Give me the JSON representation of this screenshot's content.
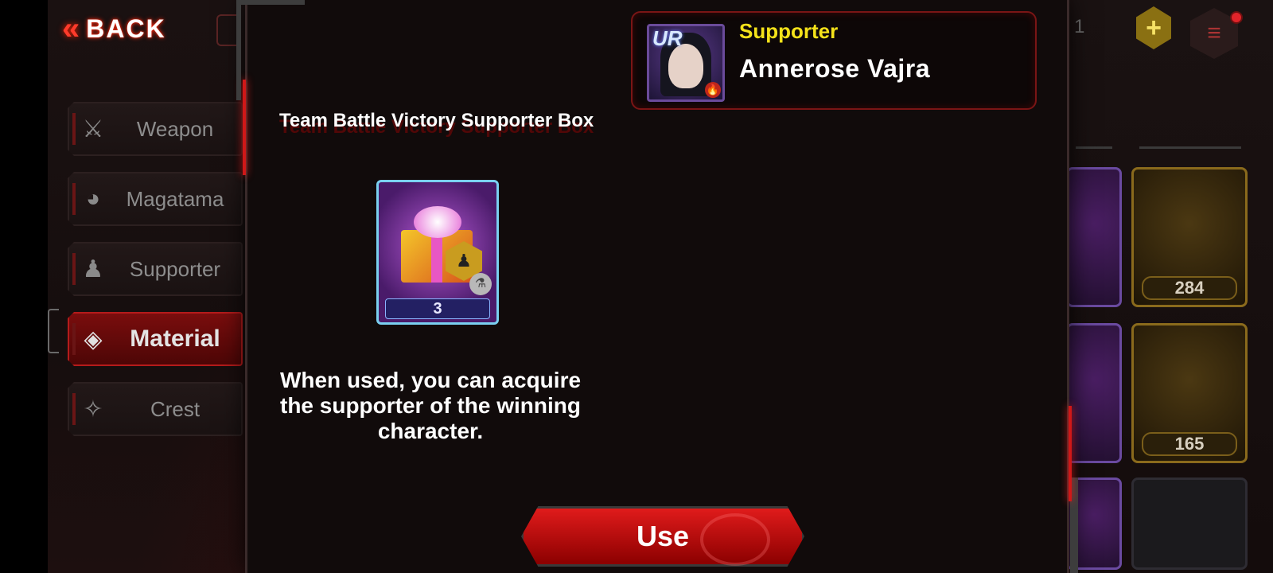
{
  "topbar": {
    "back_label": "BACK",
    "back_chevron": "«",
    "right_counter": "1",
    "plus_icon": "+",
    "menu_icon": "≡"
  },
  "sidebar": {
    "items": [
      {
        "label": "Weapon",
        "icon": "⚔"
      },
      {
        "label": "Magatama",
        "icon": "◕"
      },
      {
        "label": "Supporter",
        "icon": "♟"
      },
      {
        "label": "Material",
        "icon": "◈"
      },
      {
        "label": "Crest",
        "icon": "✧"
      }
    ]
  },
  "inventory": {
    "tiles": [
      {
        "count": "284"
      },
      {
        "count": "165"
      }
    ]
  },
  "modal": {
    "supporter_card": {
      "rank_badge": "UR",
      "label": "Supporter",
      "name": "Annerose Vajra",
      "element_icon": "🔥"
    },
    "item": {
      "title": "Team Battle Victory Supporter Box",
      "count": "3",
      "badge_icon": "♟",
      "flask_icon": "⚗"
    },
    "description": "When used, you can acquire the supporter of the winning character.",
    "use_label": "Use"
  },
  "colors": {
    "accent_red": "#d01818",
    "supporter_yellow": "#f4e21a",
    "gold": "#8a6a1c"
  }
}
